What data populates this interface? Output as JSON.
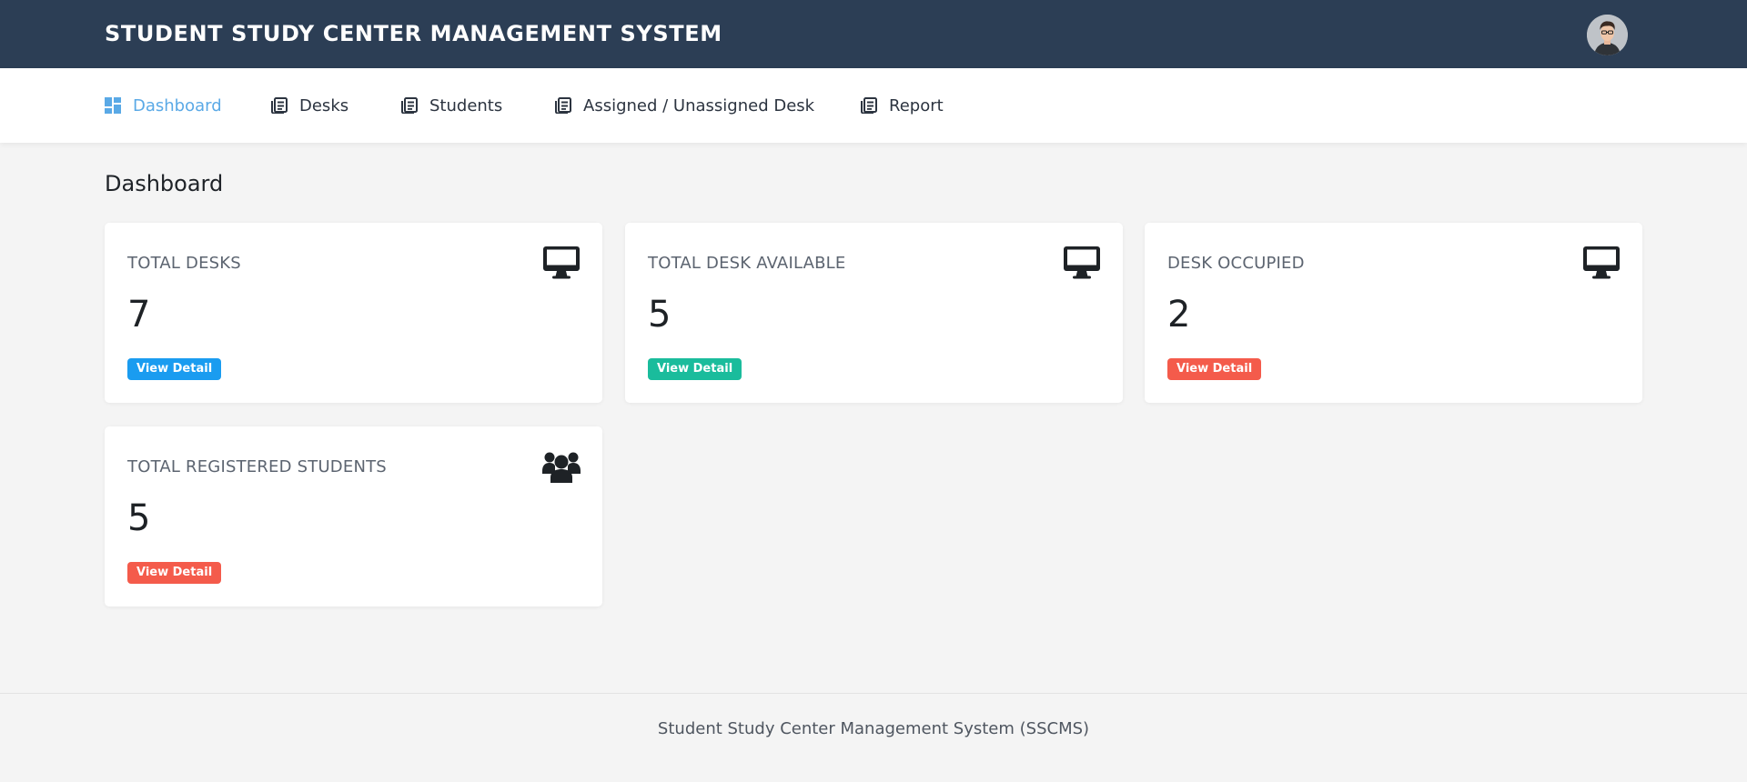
{
  "header": {
    "app_title": "STUDENT STUDY CENTER MANAGEMENT SYSTEM",
    "avatar_icon": "user-avatar"
  },
  "nav": {
    "items": [
      {
        "label": "Dashboard",
        "icon": "dashboard-icon",
        "active": true
      },
      {
        "label": "Desks",
        "icon": "newspaper-icon",
        "active": false
      },
      {
        "label": "Students",
        "icon": "newspaper-icon",
        "active": false
      },
      {
        "label": "Assigned / Unassigned Desk",
        "icon": "newspaper-icon",
        "active": false
      },
      {
        "label": "Report",
        "icon": "newspaper-icon",
        "active": false
      }
    ],
    "active_color": "#5aa9e6"
  },
  "main": {
    "title": "Dashboard",
    "cards": [
      {
        "label": "TOTAL DESKS",
        "value": "7",
        "icon": "desktop-icon",
        "button_label": "View Detail",
        "button_color": "#1a9cf0"
      },
      {
        "label": "TOTAL DESK AVAILABLE",
        "value": "5",
        "icon": "desktop-icon",
        "button_label": "View Detail",
        "button_color": "#1abc9c"
      },
      {
        "label": "DESK OCCUPIED",
        "value": "2",
        "icon": "desktop-icon",
        "button_label": "View Detail",
        "button_color": "#f45b4b"
      },
      {
        "label": "TOTAL REGISTERED STUDENTS",
        "value": "5",
        "icon": "users-icon",
        "button_label": "View Detail",
        "button_color": "#f45b4b"
      }
    ]
  },
  "footer": {
    "text": "Student Study Center Management System (SSCMS)"
  },
  "colors": {
    "header_bg": "#2c3e55",
    "page_bg": "#f4f4f4"
  }
}
